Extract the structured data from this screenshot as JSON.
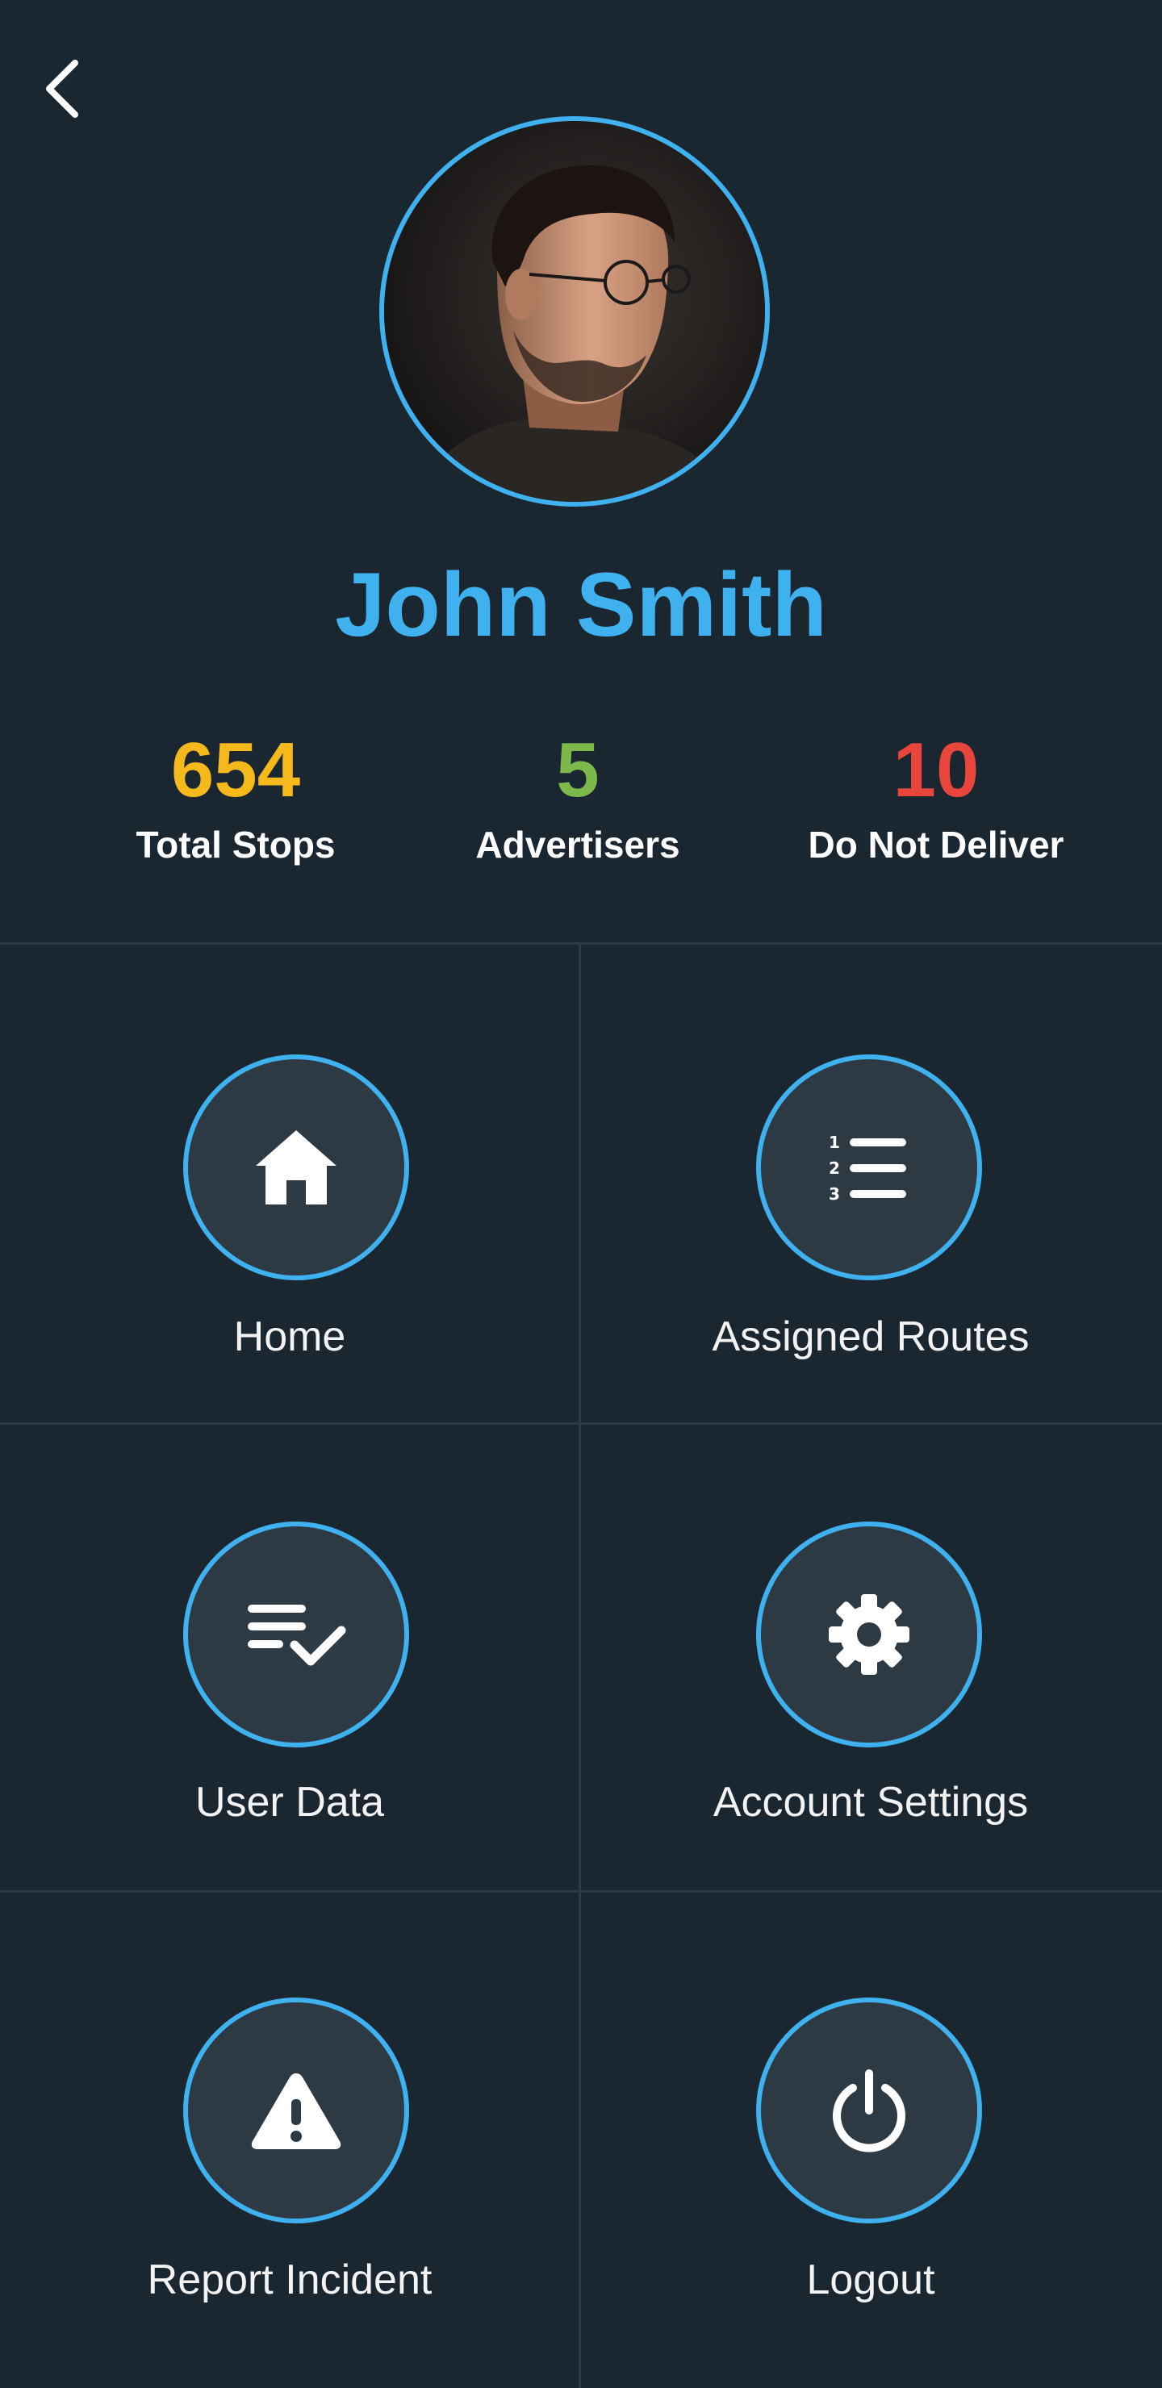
{
  "user": {
    "name": "John Smith"
  },
  "stats": [
    {
      "value": "654",
      "label": "Total Stops",
      "color": "#f5b91b"
    },
    {
      "value": "5",
      "label": "Advertisers",
      "color": "#7cb84a"
    },
    {
      "value": "10",
      "label": "Do Not Deliver",
      "color": "#e8453c"
    }
  ],
  "menu": [
    {
      "label": "Home",
      "icon": "home-icon"
    },
    {
      "label": "Assigned Routes",
      "icon": "numbered-list-icon"
    },
    {
      "label": "User Data",
      "icon": "list-check-icon"
    },
    {
      "label": "Account Settings",
      "icon": "gear-icon"
    },
    {
      "label": "Report Incident",
      "icon": "warning-icon"
    },
    {
      "label": "Logout",
      "icon": "power-icon"
    }
  ],
  "colors": {
    "accent": "#3fb1ef",
    "background": "#1a2630",
    "tile_circle": "#2d3a44"
  }
}
